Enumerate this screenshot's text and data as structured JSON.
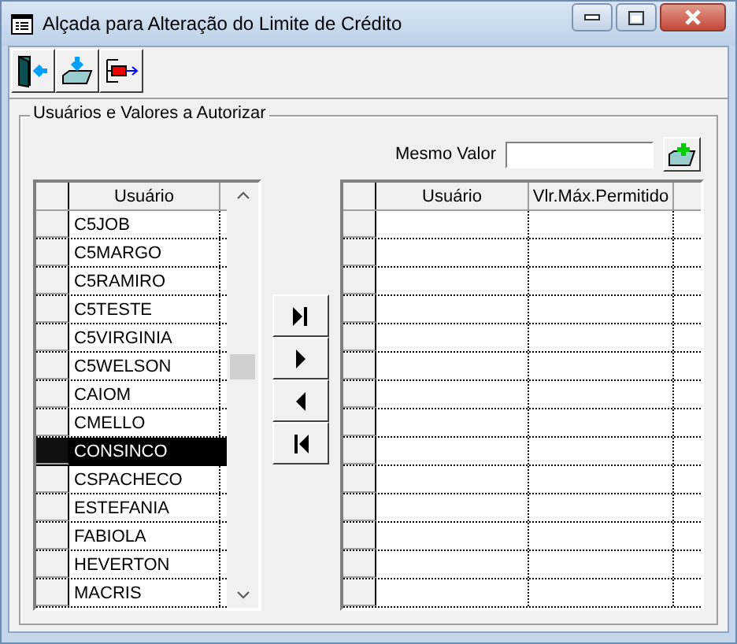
{
  "window": {
    "title": "Alçada para Alteração do Limite de Crédito"
  },
  "group": {
    "title": "Usuários e Valores a Autorizar"
  },
  "same_value": {
    "label": "Mesmo Valor"
  },
  "left_grid": {
    "columns": [
      "Usuário"
    ],
    "rows": [
      {
        "user": "C5JOB",
        "selected": false
      },
      {
        "user": "C5MARGO",
        "selected": false
      },
      {
        "user": "C5RAMIRO",
        "selected": false
      },
      {
        "user": "C5TESTE",
        "selected": false
      },
      {
        "user": "C5VIRGINIA",
        "selected": false
      },
      {
        "user": "C5WELSON",
        "selected": false
      },
      {
        "user": "CAIOM",
        "selected": false
      },
      {
        "user": "CMELLO",
        "selected": false
      },
      {
        "user": "CONSINCO",
        "selected": true
      },
      {
        "user": "CSPACHECO",
        "selected": false
      },
      {
        "user": "ESTEFANIA",
        "selected": false
      },
      {
        "user": "FABIOLA",
        "selected": false
      },
      {
        "user": "HEVERTON",
        "selected": false
      },
      {
        "user": "MACRIS",
        "selected": false
      }
    ]
  },
  "right_grid": {
    "columns": [
      "Usuário",
      "Vlr.Máx.Permitido"
    ]
  },
  "move_buttons": [
    {
      "kind": "all_right"
    },
    {
      "kind": "right"
    },
    {
      "kind": "left"
    },
    {
      "kind": "all_left"
    }
  ]
}
